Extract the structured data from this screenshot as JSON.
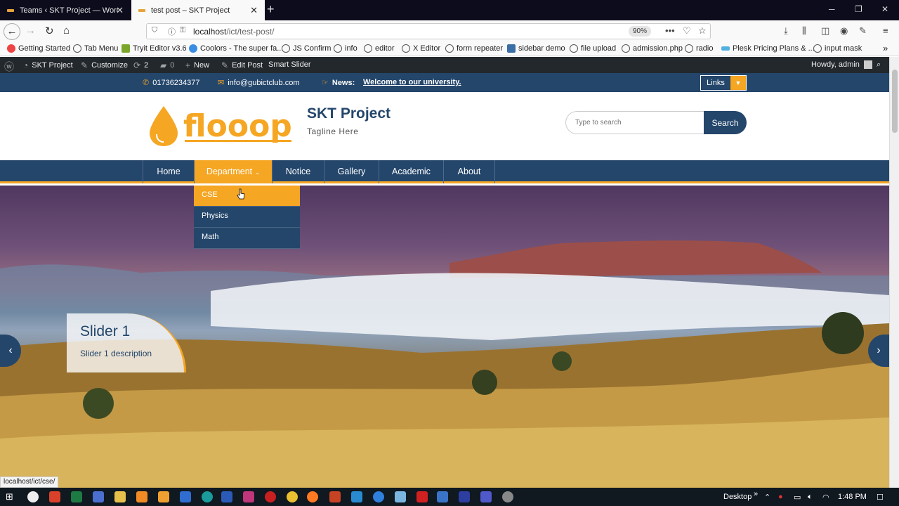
{
  "browser": {
    "tabs": [
      {
        "title": "Teams ‹ SKT Project — WordPr",
        "active": false
      },
      {
        "title": "test post – SKT Project",
        "active": true
      }
    ],
    "new_tab": "+",
    "window_controls": {
      "minimize": "─",
      "maximize": "❐",
      "close": "✕"
    },
    "url": {
      "host": "localhost",
      "path": "/ict/test-post/"
    },
    "zoom": "90%",
    "bookmarks": [
      "Getting Started",
      "Tab Menu",
      "Tryit Editor v3.6",
      "Coolors - The super fa...",
      "JS Confirm",
      "info",
      "editor",
      "X Editor",
      "form repeater",
      "sidebar demo",
      "file upload",
      "admission.php",
      "radio",
      "Plesk Pricing Plans & ...",
      "input mask"
    ],
    "status_url": "localhost/ict/cse/"
  },
  "adminbar": {
    "site": "SKT Project",
    "customize": "Customize",
    "updates": "2",
    "comments": "0",
    "new": "New",
    "edit_post": "Edit Post",
    "smart_slider": "Smart Slider",
    "howdy": "Howdy, admin"
  },
  "topbar": {
    "phone": "01736234377",
    "email": "info@gubictclub.com",
    "news_label": "News:",
    "news_text": "Welcome to our university.",
    "links_label": "Links"
  },
  "header": {
    "logo_text": "flooop",
    "site_title": "SKT Project",
    "tagline": "Tagline Here",
    "search_placeholder": "Type to search",
    "search_button": "Search"
  },
  "nav": {
    "items": [
      "Home",
      "Department",
      "Notice",
      "Gallery",
      "Academic",
      "About"
    ],
    "dropdown_caret": "⌄",
    "dropdown": [
      "CSE",
      "Physics",
      "Math"
    ]
  },
  "slider": {
    "title": "Slider 1",
    "description": "Slider 1 description",
    "prev": "‹",
    "next": "›"
  },
  "taskbar": {
    "desktop": "Desktop",
    "time": "1:48 PM"
  },
  "colors": {
    "primary": "#24466b",
    "accent": "#f5a623"
  }
}
